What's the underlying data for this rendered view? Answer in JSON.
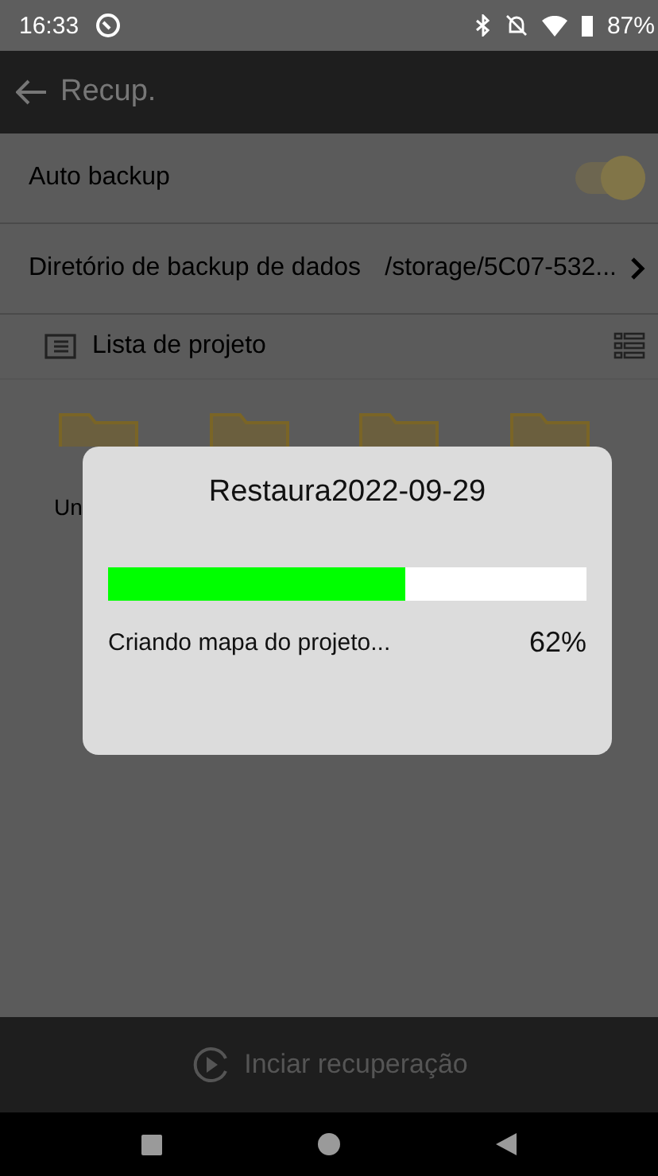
{
  "status_bar": {
    "time": "16:33",
    "battery": "87%"
  },
  "app_bar": {
    "title": "Recup."
  },
  "settings": [
    {
      "kind": "toggle",
      "label": "Auto backup",
      "on": true
    },
    {
      "kind": "link",
      "label": "Diretório de backup de dados",
      "value": "/storage/5C07-532..."
    }
  ],
  "project_list": {
    "title": "Lista de projeto",
    "folders": [
      {
        "kind": "folder",
        "label": "Un"
      },
      {
        "kind": "folder"
      },
      {
        "kind": "folder"
      },
      {
        "kind": "folder"
      }
    ]
  },
  "dialog": {
    "title": "Restaura2022-09-29",
    "level": 0.62,
    "message": "Criando mapa do projeto...",
    "percent": "62%"
  },
  "bottom_bar": {
    "button": "Inciar recuperação"
  }
}
